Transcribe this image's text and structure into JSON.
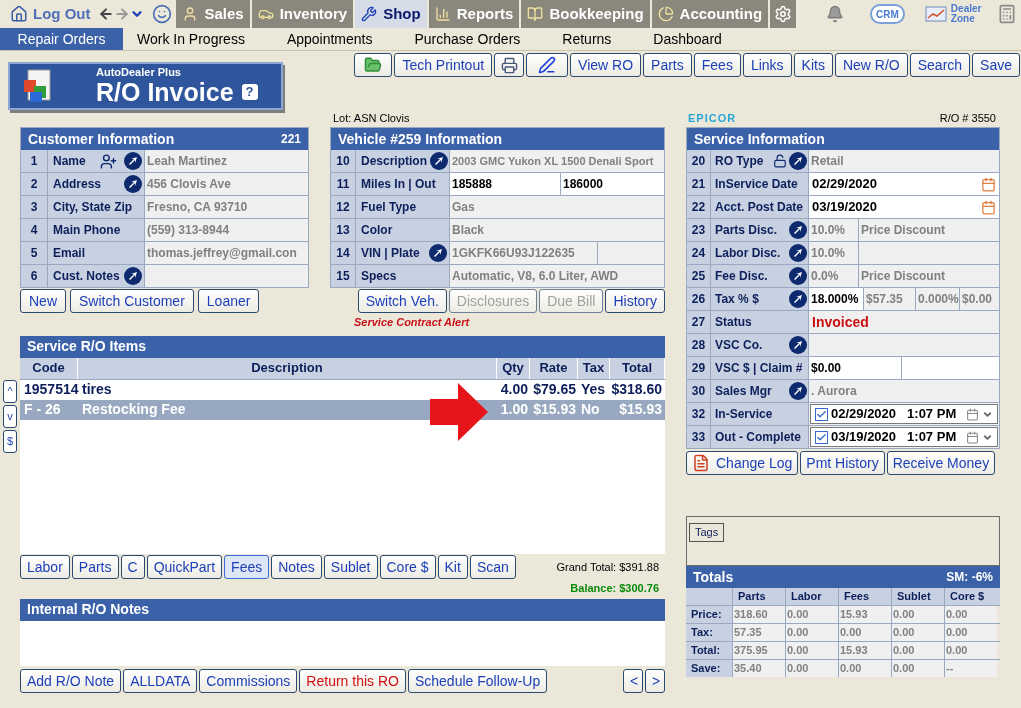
{
  "top_nav": {
    "logout": "Log Out",
    "tabs": [
      {
        "label": "Sales",
        "selected": false
      },
      {
        "label": "Inventory",
        "selected": false
      },
      {
        "label": "Shop",
        "selected": true
      },
      {
        "label": "Reports",
        "selected": false
      },
      {
        "label": "Bookkeeping",
        "selected": false
      },
      {
        "label": "Accounting",
        "selected": false
      }
    ],
    "crm": "CRM",
    "dealer_zone": "Dealer Zone"
  },
  "sub_nav": [
    {
      "label": "Repair Orders",
      "selected": true
    },
    {
      "label": "Work In Progress",
      "selected": false
    },
    {
      "label": "Appointments",
      "selected": false
    },
    {
      "label": "Purchase Orders",
      "selected": false
    },
    {
      "label": "Returns",
      "selected": false
    },
    {
      "label": "Dashboard",
      "selected": false
    }
  ],
  "toolbar": [
    {
      "kind": "folder"
    },
    {
      "kind": "text",
      "label": "Tech Printout"
    },
    {
      "kind": "printer"
    },
    {
      "kind": "sign"
    },
    {
      "kind": "text",
      "label": "View RO"
    },
    {
      "kind": "text",
      "label": "Parts"
    },
    {
      "kind": "text",
      "label": "Fees"
    },
    {
      "kind": "text",
      "label": "Links"
    },
    {
      "kind": "text",
      "label": "Kits"
    },
    {
      "kind": "text",
      "label": "New R/O"
    },
    {
      "kind": "text",
      "label": "Search"
    },
    {
      "kind": "text",
      "label": "Save"
    }
  ],
  "logo": {
    "brand": "AutoDealer Plus",
    "title": "R/O Invoice",
    "help": "?"
  },
  "lot": "Lot: ASN Clovis",
  "customer": {
    "title": "Customer Information",
    "count": "221",
    "rows": [
      {
        "num": "1",
        "label": "Name",
        "add": true,
        "link": true,
        "values": [
          {
            "text": "Leah Martinez",
            "editable": false
          }
        ]
      },
      {
        "num": "2",
        "label": "Address",
        "link": true,
        "values": [
          {
            "text": "456 Clovis Ave",
            "editable": false
          }
        ]
      },
      {
        "num": "3",
        "label": "City, State Zip",
        "values": [
          {
            "text": "Fresno, CA 93710",
            "editable": false
          }
        ]
      },
      {
        "num": "4",
        "label": "Main Phone",
        "values": [
          {
            "text": "(559) 313-8944",
            "editable": false
          }
        ]
      },
      {
        "num": "5",
        "label": "Email",
        "values": [
          {
            "text": "thomas.jeffrey@gmail.con",
            "editable": false
          }
        ]
      },
      {
        "num": "6",
        "label": "Cust. Notes",
        "link": true,
        "values": [
          {
            "editable": false
          }
        ]
      }
    ],
    "buttons": [
      {
        "label": "New",
        "disabled": false
      },
      {
        "label": "Switch Customer",
        "disabled": false
      },
      {
        "label": "Loaner",
        "disabled": false
      }
    ]
  },
  "vehicle": {
    "title": "Vehicle #259 Information",
    "rows": [
      {
        "num": "10",
        "label": "Description",
        "link": true,
        "values": [
          {
            "text": "2003 GMC Yukon XL 1500 Denali Sport",
            "editable": false
          }
        ]
      },
      {
        "num": "11",
        "label": "Miles  In | Out",
        "values": [
          {
            "text": "185888",
            "editable": true
          },
          {
            "text": "186000",
            "editable": true
          }
        ]
      },
      {
        "num": "12",
        "label": "Fuel Type",
        "values": [
          {
            "text": "Gas",
            "editable": false
          }
        ]
      },
      {
        "num": "13",
        "label": "Color",
        "values": [
          {
            "text": "Black",
            "editable": false
          }
        ]
      },
      {
        "num": "14",
        "label": "VIN | Plate",
        "link": true,
        "values": [
          {
            "text": "1GKFK66U93J122635",
            "editable": false
          },
          {
            "editable": false
          }
        ]
      },
      {
        "num": "15",
        "label": "Specs",
        "values": [
          {
            "text": "Automatic, V8, 6.0 Liter, AWD",
            "editable": false
          }
        ]
      }
    ],
    "buttons": [
      {
        "label": "Switch Veh.",
        "disabled": false
      },
      {
        "label": "Disclosures",
        "disabled": true
      },
      {
        "label": "Due Bill",
        "disabled": true
      },
      {
        "label": "History",
        "disabled": false
      }
    ],
    "alert": "Service Contract Alert"
  },
  "service": {
    "brand": "EPICOR",
    "ro_number": "R/O # 3550",
    "title": "Service Information",
    "rows": [
      {
        "num": "20",
        "label": "RO Type",
        "kind": "text",
        "lock": true,
        "link": true,
        "values": [
          {
            "text": "Retail",
            "editable": false
          }
        ]
      },
      {
        "num": "21",
        "label": "InService Date",
        "kind": "date",
        "values": [
          {
            "text": "02/29/2020",
            "editable": true
          }
        ]
      },
      {
        "num": "22",
        "label": "Acct. Post Date",
        "kind": "date",
        "values": [
          {
            "text": "03/19/2020",
            "editable": true
          }
        ]
      },
      {
        "num": "23",
        "label": "Parts Disc.",
        "kind": "text",
        "link": true,
        "values": [
          {
            "text": "10.0%",
            "editable": false
          },
          {
            "text": "Price Discount",
            "editable": false
          }
        ]
      },
      {
        "num": "24",
        "label": "Labor Disc.",
        "kind": "text",
        "link": true,
        "values": [
          {
            "text": "10.0%",
            "editable": false
          },
          {
            "editable": false
          }
        ]
      },
      {
        "num": "25",
        "label": "Fee Disc.",
        "kind": "text",
        "link": true,
        "values": [
          {
            "text": "0.0%",
            "editable": false
          },
          {
            "text": "Price Discount",
            "editable": false
          }
        ]
      },
      {
        "num": "26",
        "label": "Tax % $",
        "kind": "tax",
        "link": true,
        "values": [
          {
            "text": "18.000%",
            "editable": true
          },
          {
            "text": "$57.35",
            "editable": false
          },
          {
            "text": "0.000%",
            "editable": false
          },
          {
            "text": "$0.00",
            "editable": false
          }
        ]
      },
      {
        "num": "27",
        "label": "Status",
        "kind": "status",
        "values": [
          {
            "text": "Invoiced"
          }
        ]
      },
      {
        "num": "28",
        "label": "VSC  Co.",
        "kind": "text",
        "link": true,
        "values": [
          {
            "editable": false
          }
        ]
      },
      {
        "num": "29",
        "label": "VSC $ | Claim #",
        "kind": "text",
        "values": [
          {
            "text": "$0.00",
            "editable": true
          },
          {
            "editable": true
          }
        ]
      },
      {
        "num": "30",
        "label": "Sales Mgr",
        "kind": "text",
        "link": true,
        "values": [
          {
            "text": ". Aurora",
            "editable": false
          }
        ]
      },
      {
        "num": "32",
        "label": "In-Service",
        "kind": "datetime",
        "checked": true,
        "values": [
          {
            "text": "02/29/2020"
          },
          {
            "text": "1:07 PM"
          }
        ]
      },
      {
        "num": "33",
        "label": "Out - Complete",
        "kind": "datetime",
        "checked": true,
        "values": [
          {
            "text": "03/19/2020"
          },
          {
            "text": "1:07 PM"
          }
        ]
      }
    ],
    "buttons": [
      {
        "label": "Change Log",
        "icon": true
      },
      {
        "label": "Pmt History",
        "icon": false
      },
      {
        "label": "Receive Money",
        "icon": false
      }
    ]
  },
  "items": {
    "title": "Service R/O Items",
    "side_buttons": [
      "^",
      "v",
      "$"
    ],
    "columns": [
      "Code",
      "Description",
      "Qty",
      "Rate",
      "Tax",
      "Total"
    ],
    "rows": [
      {
        "code": "1957514",
        "description": "tires",
        "qty": "4.00",
        "rate": "$79.65",
        "tax": "Yes",
        "total": "$318.60",
        "selected": false
      },
      {
        "code": "F - 26",
        "description": "Restocking Fee",
        "qty": "1.00",
        "rate": "$15.93",
        "tax": "No",
        "total": "$15.93",
        "selected": true
      }
    ],
    "buttons": [
      {
        "label": "Labor",
        "selected": false
      },
      {
        "label": "Parts",
        "selected": false
      },
      {
        "label": "C",
        "selected": false
      },
      {
        "label": "QuickPart",
        "selected": false
      },
      {
        "label": "Fees",
        "selected": true
      },
      {
        "label": "Notes",
        "selected": false
      },
      {
        "label": "Sublet",
        "selected": false
      },
      {
        "label": "Core $",
        "selected": false
      },
      {
        "label": "Kit",
        "selected": false
      },
      {
        "label": "Scan",
        "selected": false
      }
    ],
    "grand_total": "Grand Total:  $391.88",
    "balance": "Balance: $300.76"
  },
  "notes": {
    "title": "Internal R/O Notes",
    "buttons": [
      {
        "label": "Add R/O Note",
        "kind": "normal"
      },
      {
        "label": "ALLDATA",
        "kind": "normal"
      },
      {
        "label": "Commissions",
        "kind": "normal"
      },
      {
        "label": "Return this RO",
        "kind": "danger"
      },
      {
        "label": "Schedule Follow-Up",
        "kind": "normal"
      }
    ],
    "pager": [
      "<",
      ">"
    ]
  },
  "tags": {
    "label": "Tags"
  },
  "totals": {
    "title": "Totals",
    "sm": "SM: -6%",
    "columns": [
      "Parts",
      "Labor",
      "Fees",
      "Sublet",
      "Core $"
    ],
    "rows": [
      {
        "label": "Price:",
        "values": [
          "318.60",
          "0.00",
          "15.93",
          "0.00",
          "0.00"
        ]
      },
      {
        "label": "Tax:",
        "values": [
          "57.35",
          "0.00",
          "0.00",
          "0.00",
          "0.00"
        ]
      },
      {
        "label": "Total:",
        "values": [
          "375.95",
          "0.00",
          "15.93",
          "0.00",
          "0.00"
        ]
      },
      {
        "label": "Save:",
        "values": [
          "35.40",
          "0.00",
          "0.00",
          "0.00",
          "--"
        ]
      }
    ]
  }
}
